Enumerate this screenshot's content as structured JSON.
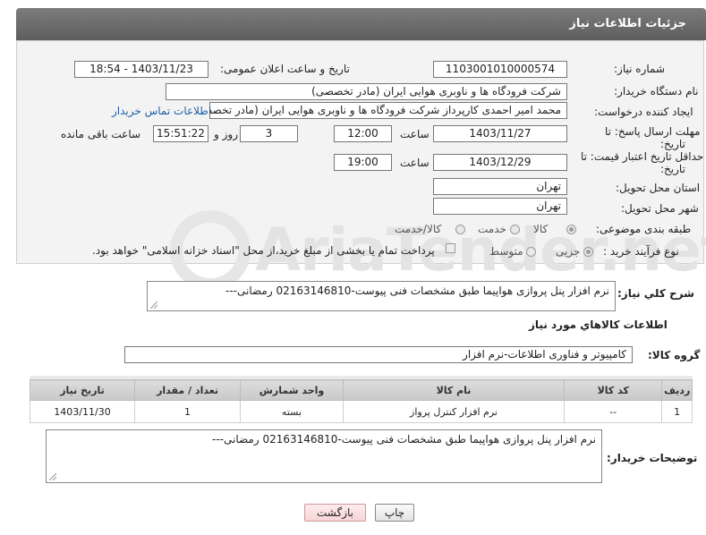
{
  "header": {
    "title": "جزئیات اطلاعات نیاز"
  },
  "watermark": {
    "text": "AriaTender.net"
  },
  "fields": {
    "need_number_label": "شماره نیاز:",
    "need_number": "1103001010000574",
    "announce_label": "تاریخ و ساعت اعلان عمومی:",
    "announce_value": "1403/11/23 - 18:54",
    "buyer_org_label": "نام دستگاه خریدار:",
    "buyer_org": "شرکت فرودگاه ها و ناوبری هوایی ایران (مادر تخصصی)",
    "creator_label": "ایجاد کننده درخواست:",
    "creator": "محمد امیر احمدی کارپرداز شرکت فرودگاه ها و ناوبری هوایی ایران (مادر تخصصی)",
    "contact_link": "اطلاعات تماس خریدار",
    "deadline_label_1": "مهلت ارسال پاسخ: تا",
    "deadline_label_2": "تاریخ:",
    "deadline_date": "1403/11/27",
    "time_label": "ساعت",
    "deadline_time": "12:00",
    "days_value": "3",
    "days_label": "روز و",
    "remaining_time": "15:51:22",
    "remaining_label": "ساعت باقی مانده",
    "validity_label_1": "حداقل تاریخ اعتبار قیمت: تا",
    "validity_label_2": "تاریخ:",
    "validity_date": "1403/12/29",
    "validity_time": "19:00",
    "province_label": "استان محل تحویل:",
    "province": "تهران",
    "city_label": "شهر محل تحویل:",
    "city": "تهران",
    "category_label": "طبقه بندی موضوعی:",
    "category_options": [
      "کالا",
      "خدمت",
      "کالا/خدمت"
    ],
    "category_selected": "کالا",
    "process_label": "نوع فرآیند خرید :",
    "process_options": [
      "جزیی",
      "متوسط"
    ],
    "process_selected": "جزیی",
    "payment_note": "پرداخت تمام یا بخشی از مبلغ خرید،از محل \"اسناد خزانه اسلامی\" خواهد بود."
  },
  "description": {
    "label": "شرح کلي نياز:",
    "text": "نرم افزار پنل پروازی هواپیما طبق مشخصات فنی پیوست-02163146810 رمضانی---"
  },
  "goods": {
    "section_title": "اطلاعات کالاهاي مورد نياز",
    "group_label": "گروه کالا:",
    "group_value": "کامپیوتر و فناوری اطلاعات-نرم افزار",
    "columns": [
      "ردیف",
      "کد کالا",
      "نام کالا",
      "واحد شمارش",
      "تعداد / مقدار",
      "تاریخ نیاز"
    ],
    "rows": [
      [
        "1",
        "--",
        "نرم افزار کنترل پرواز",
        "بسته",
        "1",
        "1403/11/30"
      ]
    ]
  },
  "buyer_notes": {
    "label": "توضیحات خریدار:",
    "text": "نرم افزار پنل پروازی هواپیما طبق مشخصات فنی پیوست-02163146810 رمضانی---"
  },
  "buttons": {
    "print": "چاپ",
    "back": "بازگشت"
  }
}
